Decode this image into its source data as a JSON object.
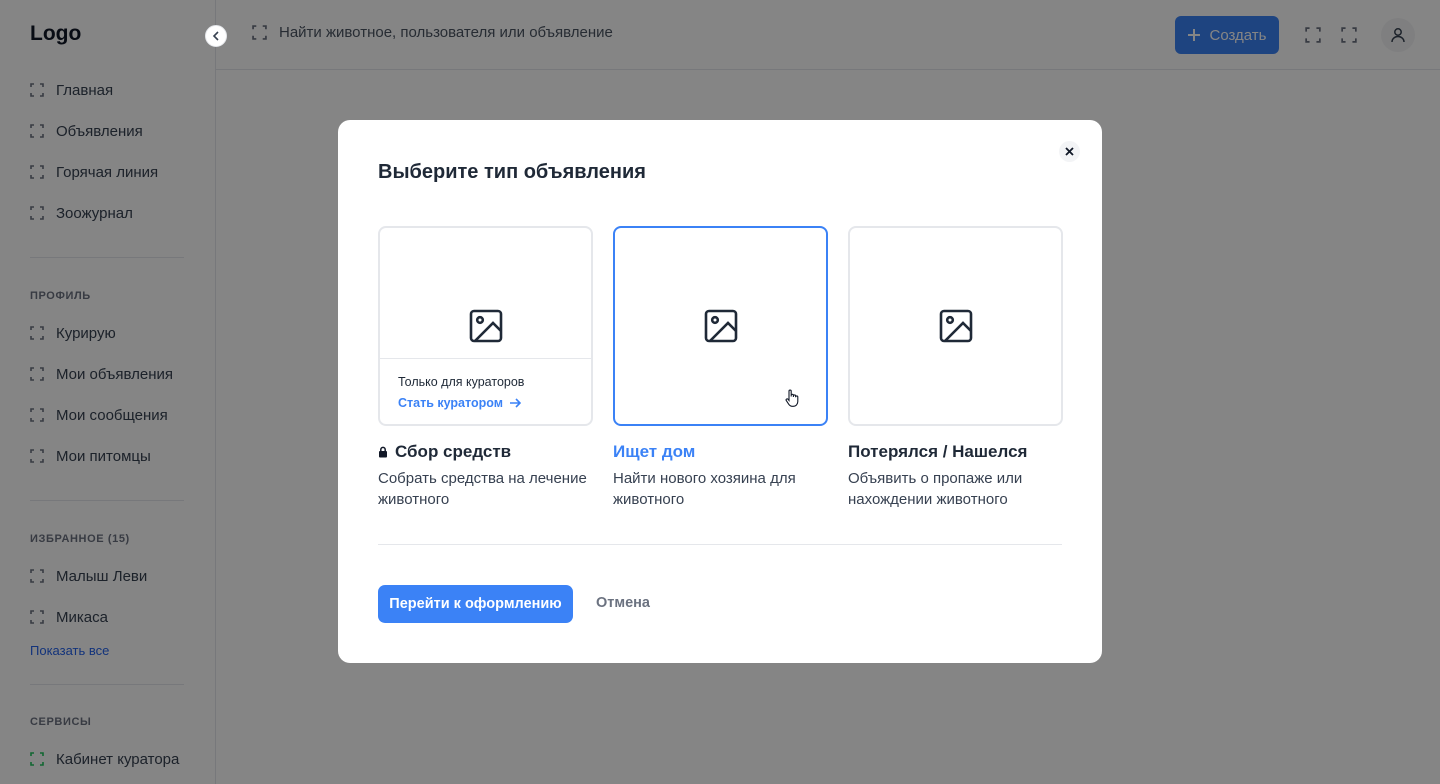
{
  "app": {
    "logo": "Logo"
  },
  "sidebar": {
    "main_items": [
      {
        "label": "Главная"
      },
      {
        "label": "Объявления"
      },
      {
        "label": "Горячая линия"
      },
      {
        "label": "Зоожурнал"
      }
    ],
    "profile_section": "ПРОФИЛЬ",
    "profile_items": [
      {
        "label": "Курирую"
      },
      {
        "label": "Мои объявления"
      },
      {
        "label": "Мои сообщения"
      },
      {
        "label": "Мои питомцы"
      }
    ],
    "favorites_section": "ИЗБРАННОЕ (15)",
    "favorites_items": [
      {
        "label": "Малыш Леви"
      },
      {
        "label": "Микаса"
      }
    ],
    "show_all": "Показать все",
    "services_section": "СЕРВИСЫ",
    "services_items": [
      {
        "label": "Кабинет куратора"
      }
    ]
  },
  "topbar": {
    "search_placeholder": "Найти животное, пользователя или объявление",
    "create_label": "Создать"
  },
  "modal": {
    "title": "Выберите тип объявления",
    "options": [
      {
        "title": "Сбор средств",
        "description": "Собрать средства на лечение животного",
        "locked": true,
        "note": "Только для кураторов",
        "link": "Стать куратором"
      },
      {
        "title": "Ищет дом",
        "description": "Найти нового хозяина для животного",
        "selected": true
      },
      {
        "title": "Потерялся / Нашелся",
        "description": "Объявить о пропаже или нахождении животного"
      }
    ],
    "primary_label": "Перейти к оформлению",
    "cancel_label": "Отмена"
  },
  "colors": {
    "accent": "#3b82f6",
    "overlay": "rgba(0,0,0,0.48)",
    "link": "#2563eb"
  },
  "icons": {
    "nav": "frame-corners-icon",
    "card": "image-icon",
    "close": "close-icon",
    "lock": "lock-icon",
    "arrow": "arrow-right-icon",
    "plus": "plus-icon",
    "user": "user-icon"
  }
}
